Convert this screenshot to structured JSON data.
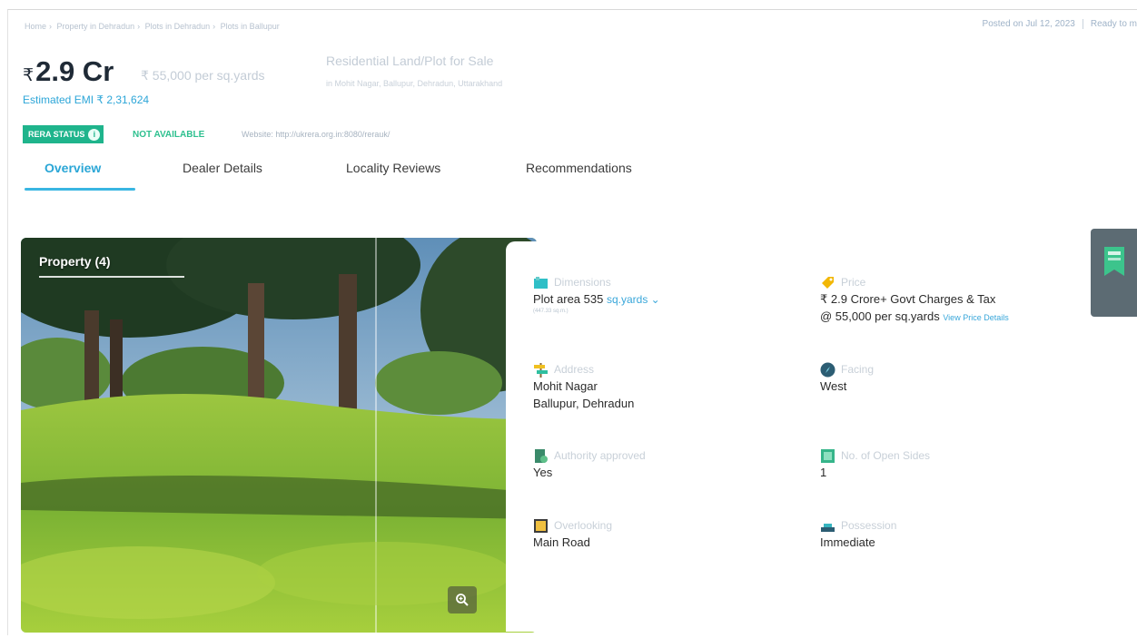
{
  "breadcrumb": [
    "Home",
    "Property in Dehradun",
    "Plots in Dehradun",
    "Plots in Ballupur"
  ],
  "posted": {
    "date": "Posted on Jul 12, 2023",
    "status": "Ready to m"
  },
  "listing": {
    "currency_symbol": "₹",
    "price": "2.9 Cr",
    "price_per_unit": "₹ 55,000 per sq.yards",
    "emi": "Estimated EMI ₹ 2,31,624",
    "title": "Residential Land/Plot for Sale",
    "address_line": "in Mohit Nagar, Ballupur, Dehradun, Uttarakhand"
  },
  "rera": {
    "badge": "RERA STATUS",
    "status": "NOT AVAILABLE",
    "website": "Website: http://ukrera.org.in:8080/rerauk/"
  },
  "tabs": [
    "Overview",
    "Dealer Details",
    "Locality Reviews",
    "Recommendations"
  ],
  "gallery": {
    "label": "Property (4)"
  },
  "details": {
    "dimensions": {
      "label": "Dimensions",
      "value": "Plot area 535",
      "unit": "sq.yards",
      "sub": "(447.33 sq.m.)"
    },
    "price": {
      "label": "Price",
      "line1": "₹ 2.9 Crore+ Govt Charges & Tax",
      "line2": "@ 55,000 per sq.yards",
      "link": "View Price Details"
    },
    "address": {
      "label": "Address",
      "line1": "Mohit Nagar",
      "line2": "Ballupur, Dehradun"
    },
    "facing": {
      "label": "Facing",
      "value": "West"
    },
    "authority": {
      "label": "Authority approved",
      "value": "Yes"
    },
    "open_sides": {
      "label": "No. of Open Sides",
      "value": "1"
    },
    "overlooking": {
      "label": "Overlooking",
      "value": "Main Road"
    },
    "possession": {
      "label": "Possession",
      "value": "Immediate"
    }
  },
  "colors": {
    "accent": "#2aa6d6",
    "rera_green": "#1fb48c",
    "side_badge": "#5c6b73"
  }
}
